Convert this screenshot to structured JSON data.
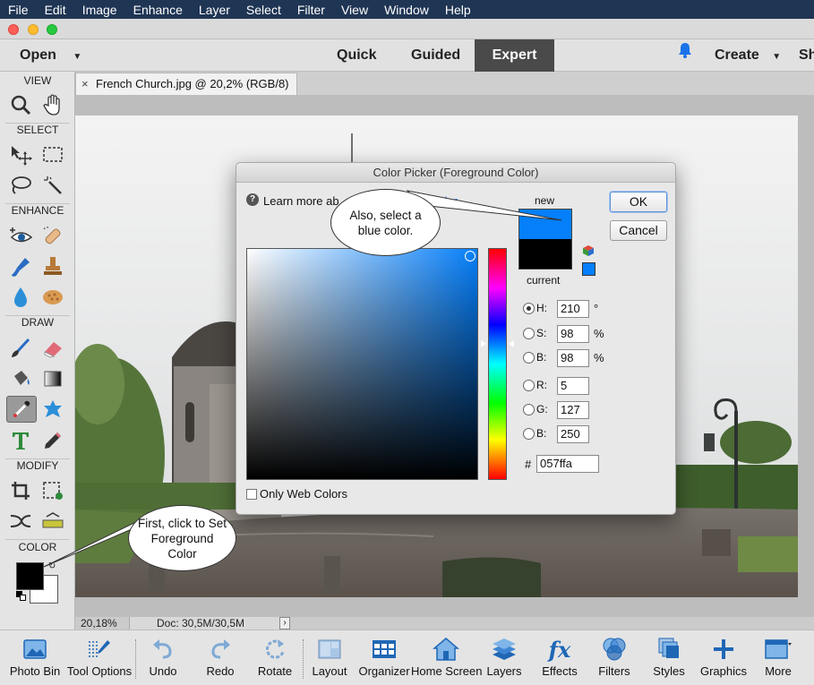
{
  "menubar": [
    "File",
    "Edit",
    "Image",
    "Enhance",
    "Layer",
    "Select",
    "Filter",
    "View",
    "Window",
    "Help"
  ],
  "modebar": {
    "open_label": "Open",
    "quick": "Quick",
    "guided": "Guided",
    "expert": "Expert",
    "create": "Create",
    "share_partial": "Sh"
  },
  "toolbox": {
    "sections": {
      "view": "VIEW",
      "select": "SELECT",
      "enhance": "ENHANCE",
      "draw": "DRAW",
      "modify": "MODIFY",
      "color": "COLOR"
    }
  },
  "document": {
    "tab_title": "French Church.jpg @ 20,2% (RGB/8) *",
    "close_glyph": "×"
  },
  "status": {
    "zoom": "20,18%",
    "doc": "Doc: 30,5M/30,5M",
    "arrow": "›"
  },
  "dialog": {
    "title": "Color Picker (Foreground Color)",
    "learn_more": "Learn more ab",
    "learn_more_link": "lor",
    "new_label": "new",
    "current_label": "current",
    "ok": "OK",
    "cancel": "Cancel",
    "fields": {
      "H": {
        "label": "H:",
        "value": "210",
        "unit": "°"
      },
      "S": {
        "label": "S:",
        "value": "98",
        "unit": "%"
      },
      "B": {
        "label": "B:",
        "value": "98",
        "unit": "%"
      },
      "R": {
        "label": "R:",
        "value": "5"
      },
      "G": {
        "label": "G:",
        "value": "127"
      },
      "Bl": {
        "label": "B:",
        "value": "250"
      }
    },
    "hex_label": "#",
    "hex_value": "057ffa",
    "only_web_colors": "Only Web Colors",
    "new_color": "#057ffa"
  },
  "callouts": {
    "blue": "Also, select a blue color.",
    "foreground": "First, click to Set Foreground Color"
  },
  "taskbar": [
    "Photo Bin",
    "Tool Options",
    "Undo",
    "Redo",
    "Rotate",
    "Layout",
    "Organizer",
    "Home Screen",
    "Layers",
    "Effects",
    "Filters",
    "Styles",
    "Graphics",
    "More"
  ],
  "colors": {
    "menubar": "#1f3554",
    "accent_blue": "#057ffa",
    "link": "#1a5fd0"
  }
}
